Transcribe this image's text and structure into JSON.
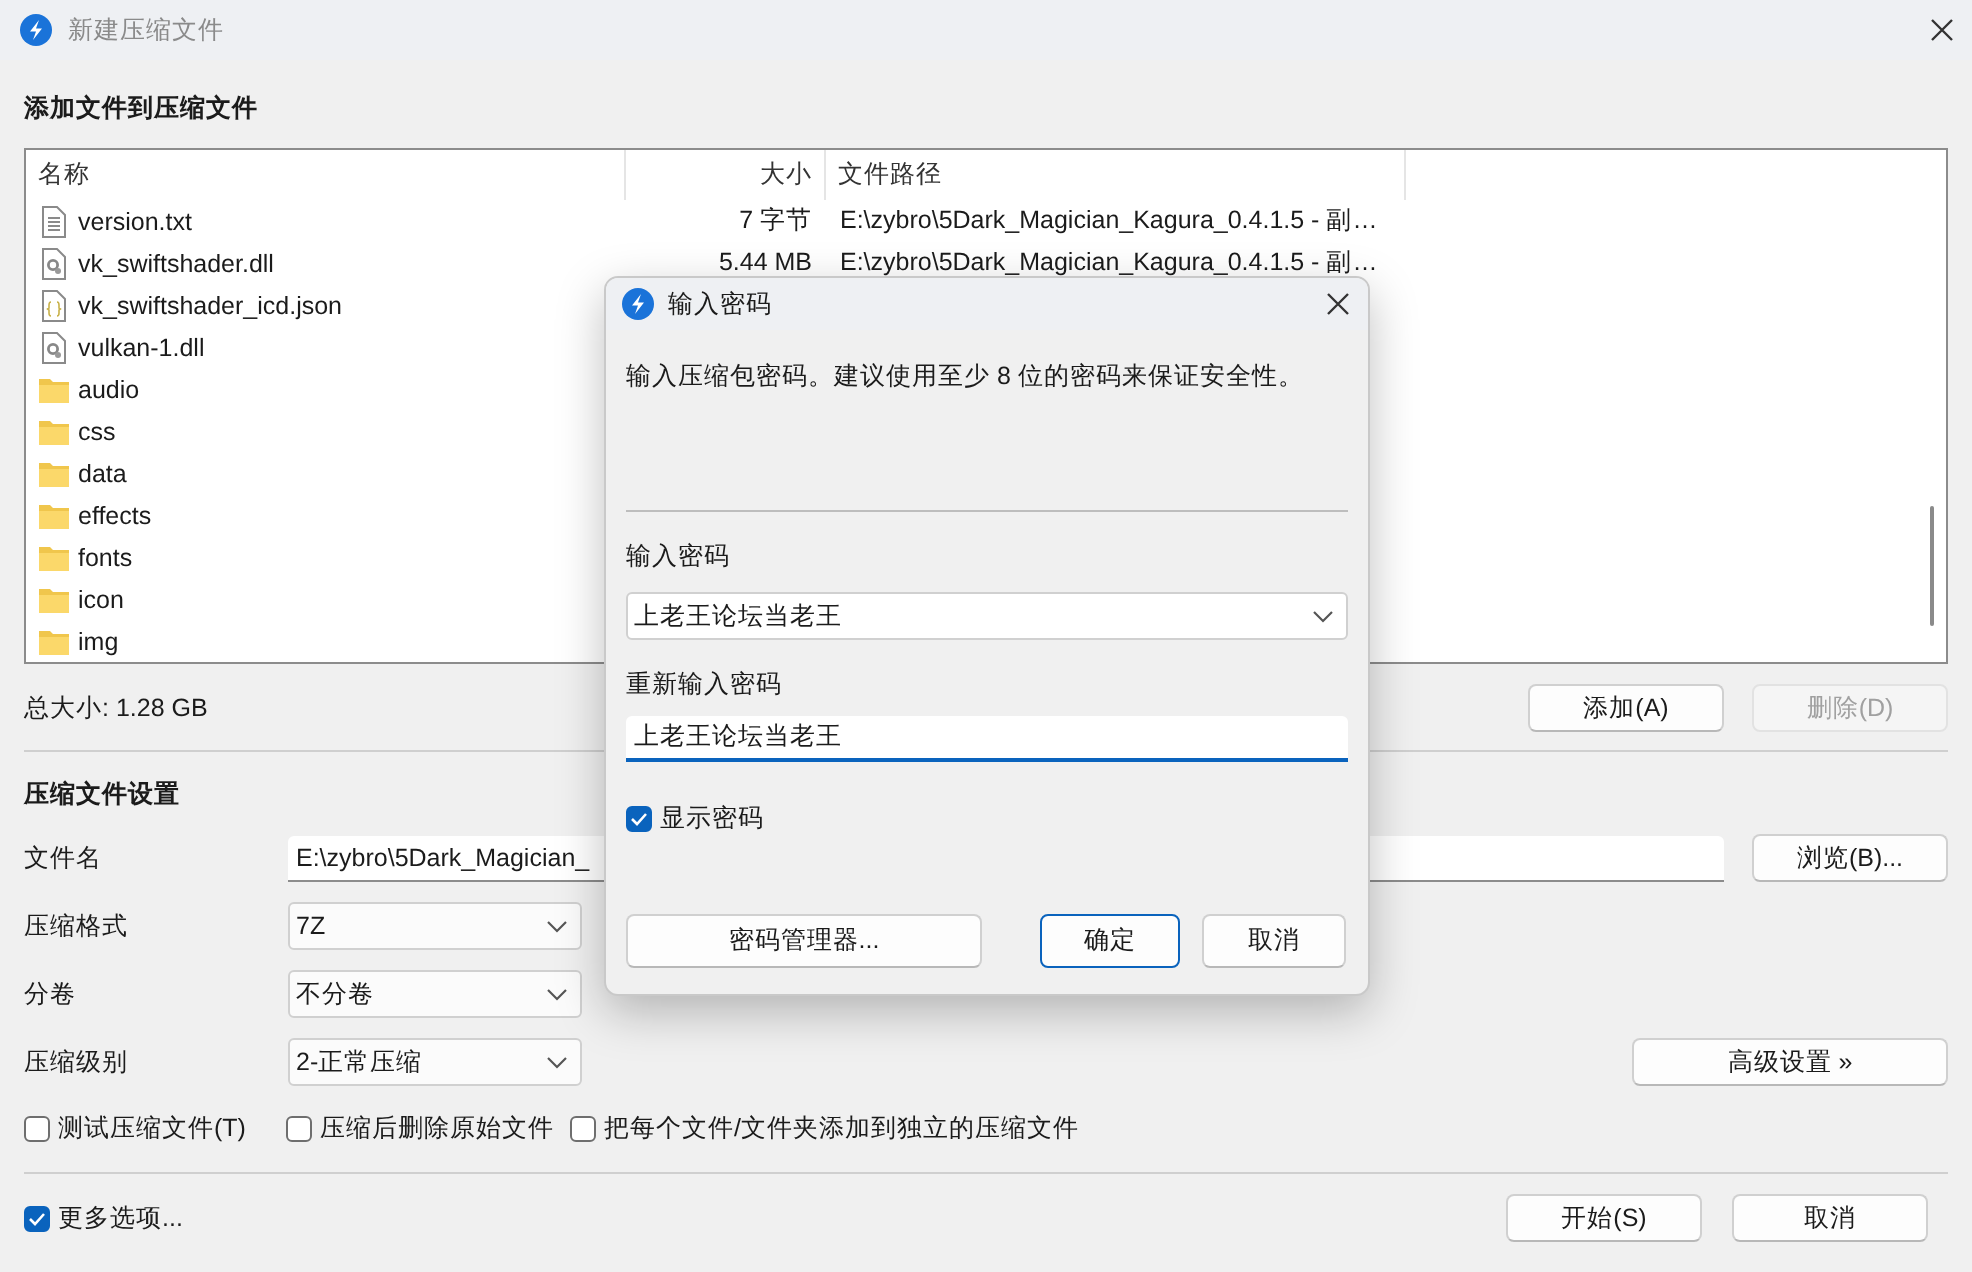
{
  "window": {
    "title": "新建压缩文件"
  },
  "files": {
    "heading": "添加文件到压缩文件",
    "columns": [
      "名称",
      "大小",
      "文件路径"
    ],
    "rows": [
      {
        "kind": "text",
        "name": "version.txt",
        "size": "7 字节",
        "path": "E:\\zybro\\5Dark_Magician_Kagura_0.4.1.5 - 副…"
      },
      {
        "kind": "dll",
        "name": "vk_swiftshader.dll",
        "size": "5.44 MB",
        "path": "E:\\zybro\\5Dark_Magician_Kagura_0.4.1.5 - 副…"
      },
      {
        "kind": "json",
        "name": "vk_swiftshader_icd.json"
      },
      {
        "kind": "dll",
        "name": "vulkan-1.dll"
      },
      {
        "kind": "folder",
        "name": "audio"
      },
      {
        "kind": "folder",
        "name": "css"
      },
      {
        "kind": "folder",
        "name": "data"
      },
      {
        "kind": "folder",
        "name": "effects"
      },
      {
        "kind": "folder",
        "name": "fonts"
      },
      {
        "kind": "folder",
        "name": "icon"
      },
      {
        "kind": "folder",
        "name": "img"
      }
    ],
    "total": "总大小: 1.28 GB",
    "buttons": [
      {
        "label": "添加(A)",
        "disabled": false
      },
      {
        "label": "删除(D)",
        "disabled": true
      }
    ]
  },
  "settings": {
    "heading": "压缩文件设置",
    "fields": [
      {
        "kind": "text",
        "label": "文件名",
        "value": "E:\\zybro\\5Dark_Magician_",
        "button": "浏览(B)..."
      },
      {
        "kind": "dropdown",
        "label": "压缩格式",
        "value": "7Z"
      },
      {
        "kind": "dropdown",
        "label": "分卷",
        "value": "不分卷"
      },
      {
        "kind": "dropdown",
        "label": "压缩级别",
        "value": "2-正常压缩",
        "button": "高级设置 »"
      }
    ],
    "options": [
      {
        "label": "测试压缩文件(T)",
        "checked": false
      },
      {
        "label": "压缩后删除原始文件",
        "checked": false
      },
      {
        "label": "把每个文件/文件夹添加到独立的压缩文件",
        "checked": false
      }
    ]
  },
  "footer": {
    "more": {
      "label": "更多选项...",
      "checked": true
    },
    "buttons": [
      "开始(S)",
      "取消"
    ]
  },
  "dialog": {
    "title": "输入密码",
    "description": "输入压缩包密码。建议使用至少 8 位的密码来保证安全性。",
    "password_label": "输入密码",
    "password": "上老王论坛当老王",
    "confirm_label": "重新输入密码",
    "confirm": "上老王论坛当老王",
    "show_password": {
      "label": "显示密码",
      "checked": true
    },
    "buttons": [
      {
        "label": "密码管理器...",
        "kind": "normal"
      },
      {
        "label": "确定",
        "kind": "default"
      },
      {
        "label": "取消",
        "kind": "normal"
      }
    ]
  }
}
